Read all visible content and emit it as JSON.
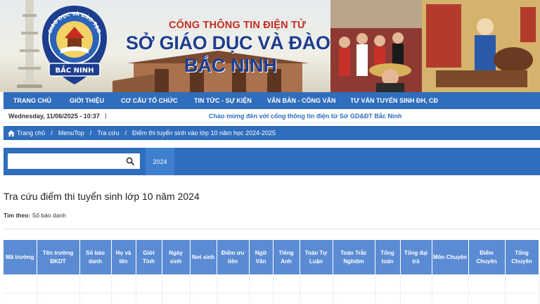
{
  "banner": {
    "logo_top_text": "GIÁO DỤC VÀ ĐÀO TẠO",
    "logo_bottom_text": "BẮC NINH",
    "title_top": "CỔNG THÔNG TIN ĐIỆN TỬ",
    "title_main": "SỞ GIÁO DỤC VÀ ĐÀO TẠO",
    "title_sub": "BẮC NINH"
  },
  "nav": {
    "items": [
      {
        "label": "TRANG CHỦ"
      },
      {
        "label": "GIỚI THIỆU"
      },
      {
        "label": "CƠ CẤU TỔ CHỨC"
      },
      {
        "label": "TIN TỨC - SỰ KIỆN"
      },
      {
        "label": "VĂN BẢN - CÔNG VĂN"
      },
      {
        "label": "TƯ VẤN TUYỂN SINH ĐH, CĐ"
      }
    ]
  },
  "infobar": {
    "date": "Wednesday, 11/06/2025 - 10:37",
    "separator": "|",
    "marquee": "Chào mừng đến với cổng thông tin điện tử Sở GD&ĐT Bắc Ninh"
  },
  "breadcrumb": {
    "items": [
      "Trang chủ",
      "MenuTop",
      "Tra cứu",
      "Điểm thi tuyển sinh vào lớp 10 năm học 2024-2025"
    ],
    "separator": "/"
  },
  "search": {
    "placeholder": "",
    "value": "",
    "year_tab": "2024"
  },
  "page": {
    "title": "Tra cứu điểm thi tuyển sinh lớp 10 năm 2024",
    "filter_label": "Tìm theo:",
    "filter_value": "Số báo danh"
  },
  "table": {
    "headers": [
      "Mã trường",
      "Tên trường ĐKDT",
      "Số báo danh",
      "Họ và tên",
      "Giới Tính",
      "Ngày sinh",
      "Nơi sinh",
      "Điểm ưu tiên",
      "Ngữ Văn",
      "Tiếng Anh",
      "Toán Tự Luận",
      "Toán Trắc Nghiệm",
      "Tổng toán",
      "Tổng đại trà",
      "Môn Chuyên",
      "Điểm Chuyên",
      "Tổng Chuyên"
    ],
    "rows": [
      [
        ".",
        ".",
        ".",
        ".",
        ".",
        ".",
        ".",
        ".",
        ".",
        ".",
        ".",
        ".",
        ".",
        ".",
        ".",
        ".",
        "."
      ],
      [
        ".",
        ".",
        ".",
        ".",
        ".",
        ".",
        ".",
        ".",
        ".",
        ".",
        ".",
        ".",
        ".",
        ".",
        ".",
        ".",
        "."
      ]
    ]
  },
  "colors": {
    "nav_blue": "#2f6dbd",
    "table_header": "#5b8bd3",
    "title_blue": "#1d3e8f",
    "title_red": "#c62b20"
  }
}
